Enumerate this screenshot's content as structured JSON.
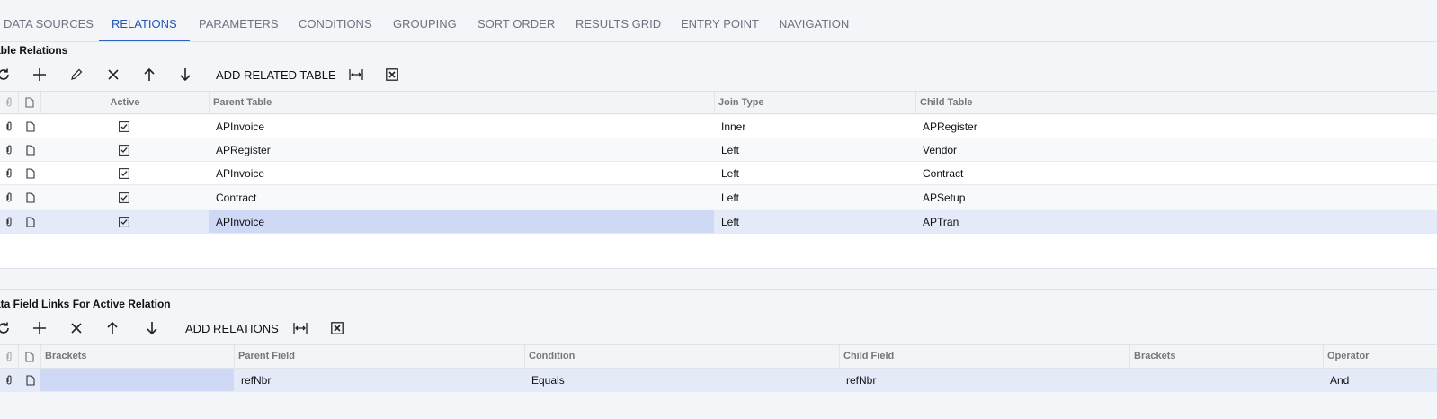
{
  "tabs": [
    "DATA SOURCES",
    "RELATIONS",
    "PARAMETERS",
    "CONDITIONS",
    "GROUPING",
    "SORT ORDER",
    "RESULTS GRID",
    "ENTRY POINT",
    "NAVIGATION"
  ],
  "active_tab": "RELATIONS",
  "relations": {
    "title": "able Relations",
    "toolbar": {
      "add_related_table": "ADD RELATED TABLE"
    },
    "columns": {
      "active": "Active",
      "parent_table": "Parent Table",
      "join_type": "Join Type",
      "child_table": "Child Table"
    },
    "rows": [
      {
        "active": true,
        "parent_table": "APInvoice",
        "join_type": "Inner",
        "child_table": "APRegister"
      },
      {
        "active": true,
        "parent_table": "APRegister",
        "join_type": "Left",
        "child_table": "Vendor"
      },
      {
        "active": true,
        "parent_table": "APInvoice",
        "join_type": "Left",
        "child_table": "Contract"
      },
      {
        "active": true,
        "parent_table": "Contract",
        "join_type": "Left",
        "child_table": "APSetup"
      },
      {
        "active": true,
        "parent_table": "APInvoice",
        "join_type": "Left",
        "child_table": "APTran"
      }
    ]
  },
  "links": {
    "title": "ata Field Links For Active Relation",
    "toolbar": {
      "add_relations": "ADD RELATIONS"
    },
    "columns": {
      "brackets_open": "Brackets",
      "parent_field": "Parent Field",
      "condition": "Condition",
      "child_field": "Child Field",
      "brackets_close": "Brackets",
      "operator": "Operator"
    },
    "rows": [
      {
        "brackets_open": "",
        "parent_field": "refNbr",
        "condition": "Equals",
        "child_field": "refNbr",
        "brackets_close": "",
        "operator": "And"
      }
    ]
  },
  "colors": {
    "accent": "#2d5fc4",
    "selected_row": "#e5eaf9",
    "selected_cell": "#cfd9f5"
  }
}
